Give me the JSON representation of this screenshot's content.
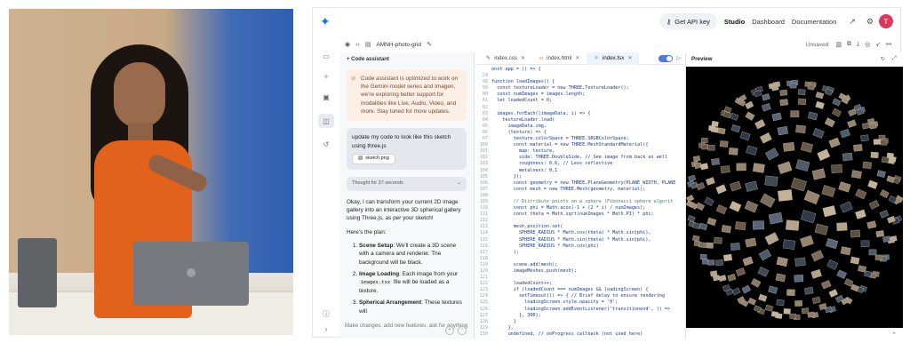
{
  "topbar": {
    "api_key": "Get API key",
    "nav": [
      "Studio",
      "Dashboard",
      "Documentation"
    ],
    "avatar": "T"
  },
  "project": {
    "name": "AMNH-photo-grid",
    "status": "Unsaved"
  },
  "chat": {
    "header": "Code assistant",
    "warning": "Code assistant is optimized to work on the Gemini model series and Imagen, we're exploring better support for modalities like Live, Audio, Video, and more. Stay tuned for more updates.",
    "user_message": "update my code to look like this sketch using three.js",
    "attachment": "sketch.png",
    "thought": "Thought for 37 seconds",
    "reply_intro": "Okay, I can transform your current 2D image gallery into an interactive 3D spherical gallery using Three.js, as per your sketch!",
    "plan_label": "Here's the plan:",
    "steps": [
      {
        "title": "Scene Setup",
        "text": ": We'll create a 3D scene with a camera and renderer. The background will be black."
      },
      {
        "title": "Image Loading",
        "pre": ": Each image from your ",
        "code": "images.tsx",
        "post": " file will be loaded as a texture."
      },
      {
        "title": "Spherical Arrangement",
        "text": ": These textures will"
      }
    ],
    "input_placeholder": "Make changes, add new features, ask for anything"
  },
  "editor": {
    "tabs": [
      "index.css",
      "index.html",
      "index.tsx"
    ],
    "active_tab": 2,
    "lines": [
      {
        "n": "",
        "t": "onst app = () => {"
      },
      {
        "n": "24",
        "t": ""
      },
      {
        "n": "98",
        "t": "function loadImages() {"
      },
      {
        "n": "99",
        "t": "  const textureLoader = new THREE.TextureLoader();"
      },
      {
        "n": "00",
        "t": "  const numImages = images.length;"
      },
      {
        "n": "01",
        "t": "  let loadedCount = 0;"
      },
      {
        "n": "02",
        "t": ""
      },
      {
        "n": "03",
        "t": "  images.forEach((imageData, i) => {"
      },
      {
        "n": "04",
        "t": "    textureLoader.load("
      },
      {
        "n": "05",
        "t": "      imageData.img,"
      },
      {
        "n": "06",
        "t": "      (texture) => {"
      },
      {
        "n": "07",
        "t": "        texture.colorSpace = THREE.SRGBColorSpace;"
      },
      {
        "n": "100",
        "t": "        const material = new THREE.MeshStandardMaterial({"
      },
      {
        "n": "101",
        "t": "          map: texture,"
      },
      {
        "n": "102",
        "t": "          side: THREE.DoubleSide, // See image from back as well"
      },
      {
        "n": "103",
        "t": "          roughness: 0.6, // Less reflective"
      },
      {
        "n": "104",
        "t": "          metalness: 0.1"
      },
      {
        "n": "105",
        "t": "        });"
      },
      {
        "n": "106",
        "t": "        const geometry = new THREE.PlaneGeometry(PLANE_WIDTH, PLANE"
      },
      {
        "n": "107",
        "t": "        const mesh = new THREE.Mesh(geometry, material);"
      },
      {
        "n": "108",
        "t": ""
      },
      {
        "n": "109",
        "t": "        // Distribute points on a sphere (Fibonacci sphere algorit"
      },
      {
        "n": "110",
        "t": "        const phi = Math.acos(-1 + (2 * i) / numImages);"
      },
      {
        "n": "111",
        "t": "        const theta = Math.sqrt(numImages * Math.PI) * phi;"
      },
      {
        "n": "112",
        "t": ""
      },
      {
        "n": "113",
        "t": "        mesh.position.set("
      },
      {
        "n": "114",
        "t": "          SPHERE_RADIUS * Math.cos(theta) * Math.sin(phi),"
      },
      {
        "n": "115",
        "t": "          SPHERE_RADIUS * Math.sin(theta) * Math.sin(phi),"
      },
      {
        "n": "116",
        "t": "          SPHERE_RADIUS * Math.cos(phi)"
      },
      {
        "n": "117",
        "t": "        );"
      },
      {
        "n": "118",
        "t": ""
      },
      {
        "n": "119",
        "t": "        scene.add(mesh);"
      },
      {
        "n": "120",
        "t": "        imageMeshes.push(mesh);"
      },
      {
        "n": "121",
        "t": ""
      },
      {
        "n": "122",
        "t": "        loadedCount++;"
      },
      {
        "n": "123",
        "t": "        if (loadedCount === numImages && loadingScreen) {"
      },
      {
        "n": "124",
        "t": "          setTimeout(() => { // Brief delay to ensure rendering"
      },
      {
        "n": "125",
        "t": "            loadingScreen.style.opacity = '0';"
      },
      {
        "n": "126",
        "t": "            loadingScreen.addEventListener('transitionend', () =>"
      },
      {
        "n": "127",
        "t": "          }, 300);"
      },
      {
        "n": "128",
        "t": "        }"
      },
      {
        "n": "129",
        "t": "      },"
      },
      {
        "n": "130",
        "t": "      undefined, // onProgress callback (not used here)"
      }
    ]
  },
  "preview": {
    "title": "Preview"
  }
}
